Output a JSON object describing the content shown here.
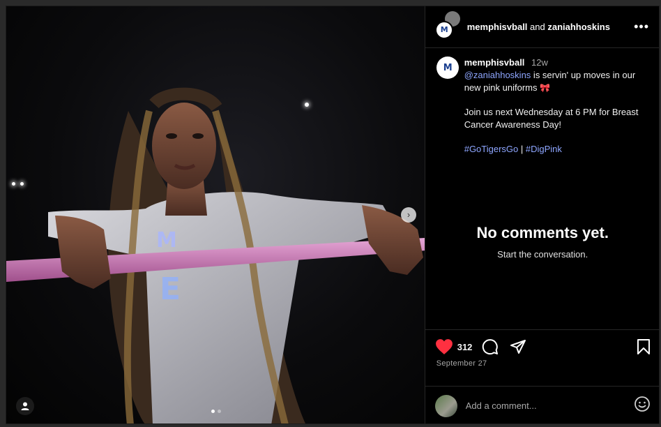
{
  "header": {
    "username": "memphisvball",
    "and_text": " and ",
    "collaborator": "zaniahhoskins",
    "more_icon": "more-horizontal-icon"
  },
  "caption": {
    "username": "memphisvball",
    "time": "12w",
    "mention": "@zaniahhoskins",
    "line1_rest": " is servin' up moves in our new pink uniforms ",
    "emoji": "🎀",
    "para2": "Join us next Wednesday at 6 PM for Breast Cancer Awareness Day!",
    "tag1": "#GoTigersGo",
    "separator": " | ",
    "tag2": "#DigPink"
  },
  "comments": {
    "empty_title": "No comments yet.",
    "empty_subtitle": "Start the conversation."
  },
  "actions": {
    "like_count": "312",
    "date": "September 27",
    "like_color": "#ff3040"
  },
  "comment_box": {
    "placeholder": "Add a comment..."
  },
  "media": {
    "description_icon": "photo",
    "carousel": {
      "count": 2,
      "active": 1
    }
  },
  "colors": {
    "background": "#000000",
    "link": "#8ea6ff",
    "muted": "#a8a8a8"
  }
}
